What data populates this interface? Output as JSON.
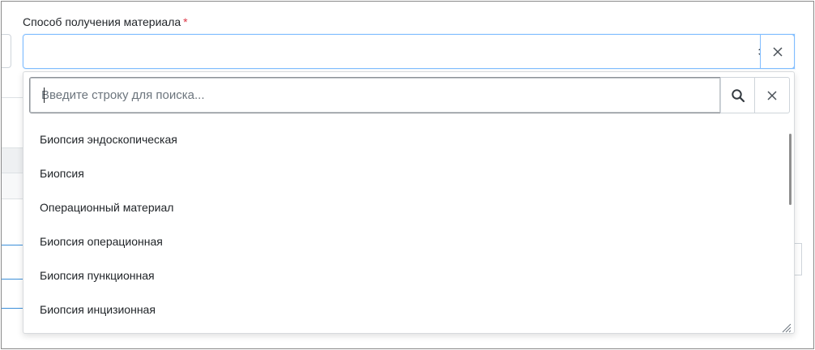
{
  "field": {
    "label": "Способ получения материала",
    "required_mark": "*",
    "selected_value": ""
  },
  "search": {
    "placeholder": "Введите строку для поиска...",
    "value": ""
  },
  "options": [
    "Биопсия эндоскопическая",
    "Биопсия",
    "Операционный материал",
    "Биопсия операционная",
    "Биопсия пункционная",
    "Биопсия инцизионная"
  ],
  "icons": {
    "select_arrows": "sort-arrows-icon",
    "select_clear": "close-icon",
    "search": "search-icon",
    "search_clear": "close-icon",
    "resize": "resize-grip-icon"
  },
  "colors": {
    "focus_border": "#80bdff",
    "required": "#dc3545",
    "text": "#212529",
    "accent_lines": "#3b8fd9"
  }
}
